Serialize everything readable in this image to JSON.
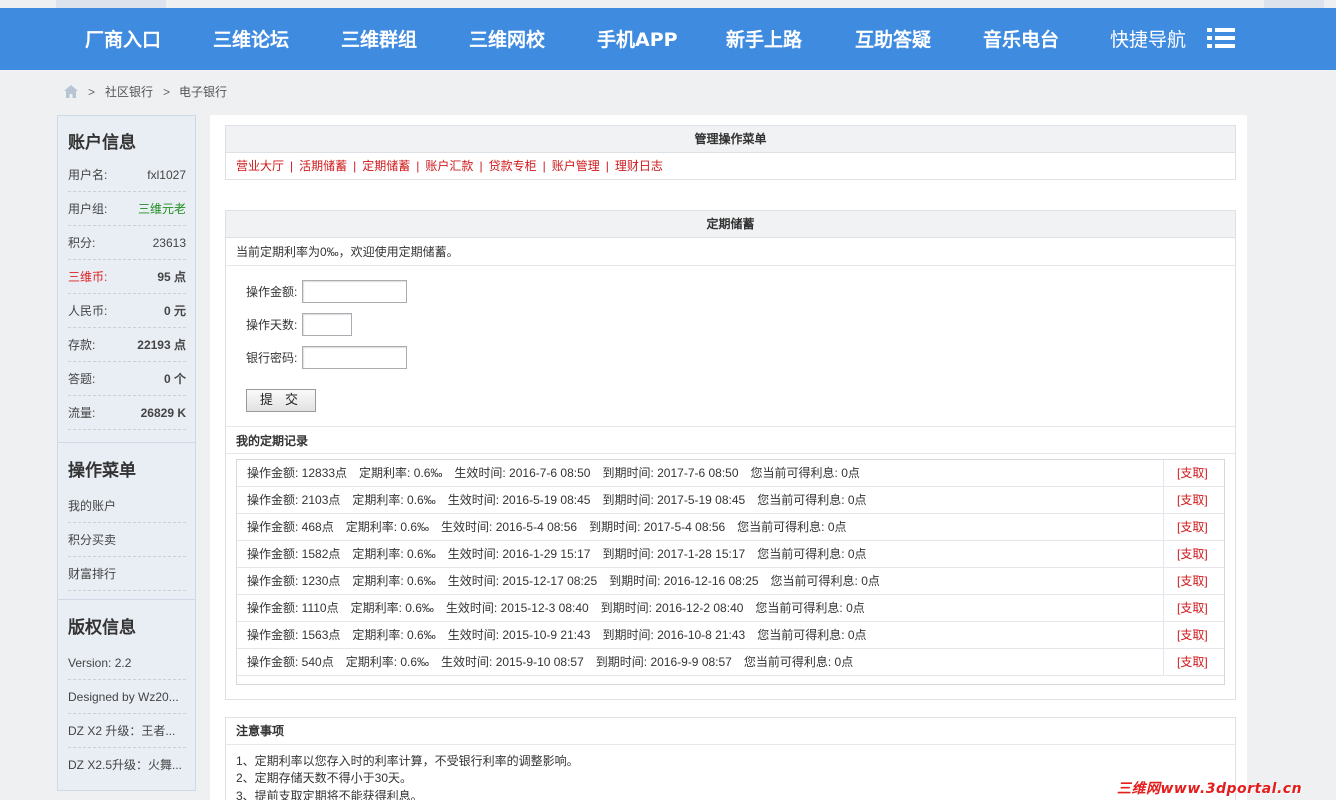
{
  "nav": {
    "items": [
      "厂商入口",
      "三维论坛",
      "三维群组",
      "三维网校",
      "手机APP",
      "新手上路",
      "互助答疑",
      "音乐电台"
    ],
    "quick_nav": "快捷导航"
  },
  "breadcrumb": [
    "社区银行",
    "电子银行"
  ],
  "sidebar": {
    "account_title": "账户信息",
    "account": [
      {
        "k": "用户名:",
        "v": "fxl1027"
      },
      {
        "k": "用户组:",
        "v": "三维元老"
      },
      {
        "k": "积分:",
        "v": "23613"
      },
      {
        "k": "三维币:",
        "v": "95 点"
      },
      {
        "k": "人民币:",
        "v": "0 元"
      },
      {
        "k": "存款:",
        "v": "22193 点"
      },
      {
        "k": "答题:",
        "v": "0 个"
      },
      {
        "k": "流量:",
        "v": "26829 K"
      }
    ],
    "menu_title": "操作菜单",
    "menu": [
      "我的账户",
      "积分买卖",
      "财富排行"
    ],
    "copyright_title": "版权信息",
    "copyright": [
      "Version: 2.2",
      "Designed by Wz20...",
      "DZ X2 升级：王者...",
      "DZ X2.5升级：火舞..."
    ]
  },
  "admin_menu": {
    "title": "管理操作菜单",
    "links": [
      "营业大厅",
      "活期储蓄",
      "定期储蓄",
      "账户汇款",
      "贷款专柜",
      "账户管理",
      "理财日志"
    ]
  },
  "fixed": {
    "title": "定期储蓄",
    "intro": "当前定期利率为0‰，欢迎使用定期储蓄。",
    "amount_label": "操作金额:",
    "days_label": "操作天数:",
    "password_label": "银行密码:",
    "amount_value": "",
    "days_value": "",
    "password_value": "",
    "submit": "提 交",
    "records_title": "我的定期记录",
    "records": [
      "操作金额: 12833点　定期利率: 0.6‰　生效时间: 2016-7-6 08:50　到期时间: 2017-7-6 08:50　您当前可得利息: 0点",
      "操作金额: 2103点　定期利率: 0.6‰　生效时间: 2016-5-19 08:45　到期时间: 2017-5-19 08:45　您当前可得利息: 0点",
      "操作金额: 468点　定期利率: 0.6‰　生效时间: 2016-5-4 08:56　到期时间: 2017-5-4 08:56　您当前可得利息: 0点",
      "操作金额: 1582点　定期利率: 0.6‰　生效时间: 2016-1-29 15:17　到期时间: 2017-1-28 15:17　您当前可得利息: 0点",
      "操作金额: 1230点　定期利率: 0.6‰　生效时间: 2015-12-17 08:25　到期时间: 2016-12-16 08:25　您当前可得利息: 0点",
      "操作金额: 1110点　定期利率: 0.6‰　生效时间: 2015-12-3 08:40　到期时间: 2016-12-2 08:40　您当前可得利息: 0点",
      "操作金额: 1563点　定期利率: 0.6‰　生效时间: 2015-10-9 21:43　到期时间: 2016-10-8 21:43　您当前可得利息: 0点",
      "操作金额: 540点　定期利率: 0.6‰　生效时间: 2015-9-10 08:57　到期时间: 2016-9-9 08:57　您当前可得利息: 0点"
    ],
    "withdraw": "[支取]"
  },
  "notes": {
    "title": "注意事项",
    "lines": [
      "1、定期利率以您存入时的利率计算，不受银行利率的调整影响。",
      "2、定期存储天数不得小于30天。",
      "3、提前支取定期将不能获得利息。"
    ]
  },
  "watermark": "三维网www.3dportal.cn",
  "colors": {
    "nav_bg": "#3f8be0",
    "link_red": "#d0191c",
    "group_green": "#1e8f1e"
  }
}
